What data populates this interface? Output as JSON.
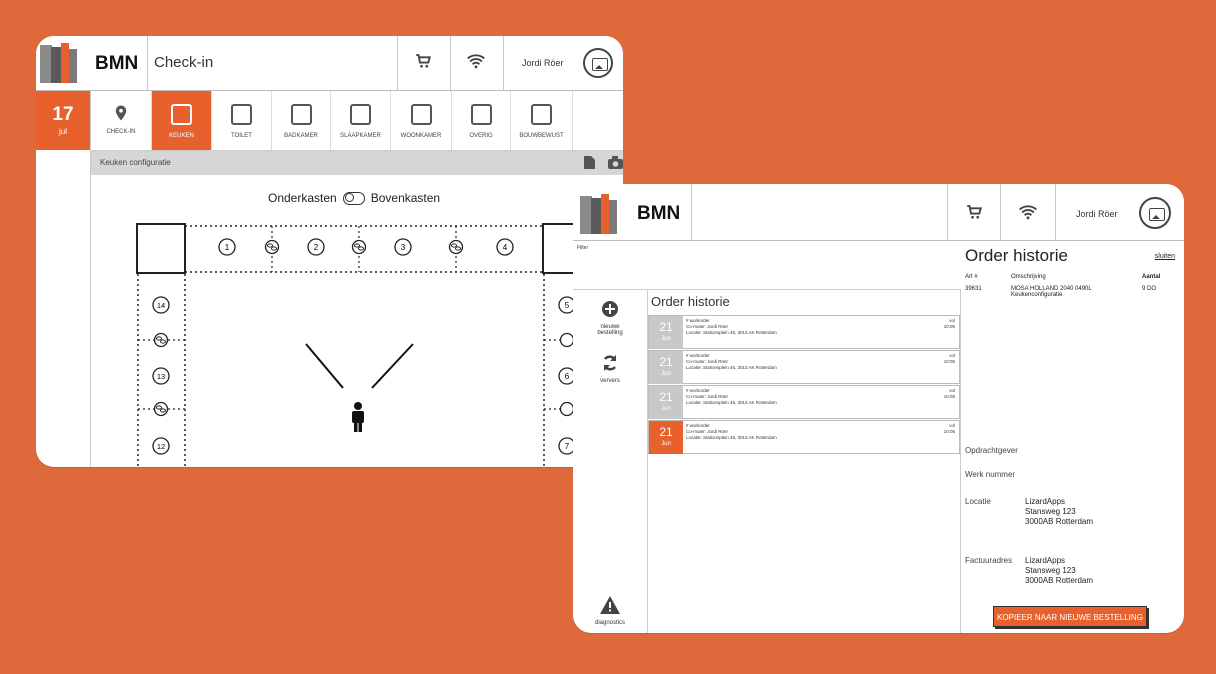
{
  "colors": {
    "background": "#de6a3c",
    "accent": "#e8612c"
  },
  "checkin": {
    "brand": "BMN",
    "title": "Check-in",
    "user": "Jordi Röer",
    "icons": {
      "cart": "cart-icon",
      "wifi": "wifi-icon",
      "avatar": "image-icon"
    },
    "date": {
      "day": "17",
      "month": "jul"
    },
    "tabs": [
      {
        "label": "CHECK-IN",
        "icon": "map-pin-icon",
        "active": false
      },
      {
        "label": "KEUKEN",
        "active": true
      },
      {
        "label": "TOILET",
        "active": false
      },
      {
        "label": "BADKAMER",
        "active": false
      },
      {
        "label": "SLAAPKAMER",
        "active": false
      },
      {
        "label": "WOONKAMER",
        "active": false
      },
      {
        "label": "OVERIG",
        "active": false
      },
      {
        "label": "BOUWBEWUST",
        "active": false
      }
    ],
    "config_title": "Keuken configuratie",
    "toggle": {
      "left": "Onderkasten",
      "right": "Bovenkasten"
    },
    "top_numbers": [
      "1",
      "2",
      "3",
      "4"
    ],
    "left_numbers": [
      "14",
      "13",
      "12"
    ],
    "right_numbers": [
      "5",
      "6",
      "7"
    ]
  },
  "orders": {
    "brand": "BMN",
    "user": "Jordi Röer",
    "filter_label": "Filter",
    "sidebar": [
      {
        "label": "nieuwe bestelling",
        "icon": "plus-circle-icon"
      },
      {
        "label": "ververs",
        "icon": "refresh-icon"
      },
      {
        "label": "diagnostics",
        "icon": "warning-icon"
      }
    ],
    "list_title": "Order historie",
    "items": [
      {
        "day": "21",
        "month": "Jun",
        "workorder": "# workorder",
        "customer": "Co-muter: Jordi Röer",
        "location": "Locatie: Stationsplein 45, 3013 AK Rotterdam",
        "day_label": "vol",
        "time": "10:05",
        "active": false
      },
      {
        "day": "21",
        "month": "Jun",
        "workorder": "# workorder",
        "customer": "Co-muter: Jordi Röer",
        "location": "Locatie: Stationsplein 45, 3013 AK Rotterdam",
        "day_label": "vol",
        "time": "10:05",
        "active": false
      },
      {
        "day": "21",
        "month": "Jun",
        "workorder": "# workorder",
        "customer": "Co-muter: Jordi Röer",
        "location": "Locatie: Stationsplein 45, 3013 AK Rotterdam",
        "day_label": "vol",
        "time": "10:05",
        "active": false
      },
      {
        "day": "21",
        "month": "Jun",
        "workorder": "# workorder",
        "customer": "Co-muter: Jordi Röer",
        "location": "Locatie: Stationsplein 45, 3013 AK Rotterdam",
        "day_label": "vol",
        "time": "10:05",
        "active": true
      }
    ],
    "detail": {
      "title": "Order historie",
      "close": "sluiten",
      "headers": {
        "art": "Art #",
        "desc": "Omschrijving",
        "qty": "Aantal"
      },
      "line": {
        "art": "39631",
        "desc": "MOSA HOLLAND 2040 0490L",
        "desc2": "Keukenconfiguratie",
        "qty": "9 DO"
      },
      "opdrachtgever_label": "Opdrachtgever",
      "werknummer_label": "Werk nummer",
      "locatie_label": "Locatie",
      "locatie": [
        "LizardApps",
        "Stansweg 123",
        "3000AB Rotterdam"
      ],
      "factuur_label": "Factuuradres",
      "factuur": [
        "LizardApps",
        "Stansweg 123",
        "3000AB Rotterdam"
      ],
      "copy_button": "KOPIEER NAAR NIEUWE BESTELLING"
    }
  }
}
